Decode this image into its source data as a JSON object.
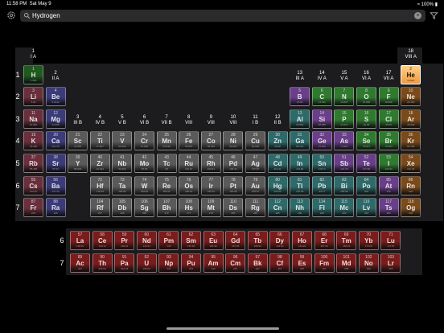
{
  "status": {
    "time": "11:58 PM",
    "date": "Sat May 9",
    "battery": "100%"
  },
  "search": {
    "value": "Hydrogen",
    "clear_icon": "clear-circle-icon"
  },
  "colors": {
    "alkali": "#6a2f3c",
    "alkaline": "#3b3b7a",
    "transition": "#5a5a5a",
    "lanthanide": "#7a1c1c",
    "actinide": "#7a1c1c",
    "post_transition": "#2f6a6a",
    "metalloid": "#6a3f8a",
    "nonmetal": "#2f7a2f",
    "halogen": "#6a6a2a",
    "noble": "#7a4a1a",
    "selected": "#f29a3a",
    "hydrogen": "#1f5a1f"
  },
  "groups": [
    {
      "num": "1",
      "sub": "I A"
    },
    {
      "num": "2",
      "sub": "II A"
    },
    {
      "num": "3",
      "sub": "III B"
    },
    {
      "num": "4",
      "sub": "IV B"
    },
    {
      "num": "5",
      "sub": "V B"
    },
    {
      "num": "6",
      "sub": "VI B"
    },
    {
      "num": "7",
      "sub": "VII B"
    },
    {
      "num": "8",
      "sub": "VIII"
    },
    {
      "num": "9",
      "sub": "VIII"
    },
    {
      "num": "10",
      "sub": "VIII"
    },
    {
      "num": "11",
      "sub": "I B"
    },
    {
      "num": "12",
      "sub": "II B"
    },
    {
      "num": "13",
      "sub": "III A"
    },
    {
      "num": "14",
      "sub": "IV A"
    },
    {
      "num": "15",
      "sub": "V A"
    },
    {
      "num": "16",
      "sub": "VI A"
    },
    {
      "num": "17",
      "sub": "VII A"
    },
    {
      "num": "18",
      "sub": "VIII A"
    }
  ],
  "periods": [
    "1",
    "2",
    "3",
    "4",
    "5",
    "6",
    "7"
  ],
  "fblock_periods": [
    "6",
    "7"
  ],
  "elements": [
    {
      "z": 1,
      "s": "H",
      "m": "1.008",
      "g": 1,
      "p": 1,
      "c": "hydrogen"
    },
    {
      "z": 2,
      "s": "He",
      "m": "4.0026",
      "g": 18,
      "p": 1,
      "c": "selected",
      "sel": true
    },
    {
      "z": 3,
      "s": "Li",
      "m": "6.94",
      "g": 1,
      "p": 2,
      "c": "alkali"
    },
    {
      "z": 4,
      "s": "Be",
      "m": "9.0122",
      "g": 2,
      "p": 2,
      "c": "alkaline"
    },
    {
      "z": 5,
      "s": "B",
      "m": "10.81",
      "g": 13,
      "p": 2,
      "c": "metalloid"
    },
    {
      "z": 6,
      "s": "C",
      "m": "12.011",
      "g": 14,
      "p": 2,
      "c": "nonmetal"
    },
    {
      "z": 7,
      "s": "N",
      "m": "14.007",
      "g": 15,
      "p": 2,
      "c": "nonmetal"
    },
    {
      "z": 8,
      "s": "O",
      "m": "15.999",
      "g": 16,
      "p": 2,
      "c": "nonmetal"
    },
    {
      "z": 9,
      "s": "F",
      "m": "18.998",
      "g": 17,
      "p": 2,
      "c": "nonmetal"
    },
    {
      "z": 10,
      "s": "Ne",
      "m": "20.180",
      "g": 18,
      "p": 2,
      "c": "noble"
    },
    {
      "z": 11,
      "s": "Na",
      "m": "22.990",
      "g": 1,
      "p": 3,
      "c": "alkali"
    },
    {
      "z": 12,
      "s": "Mg",
      "m": "24.305",
      "g": 2,
      "p": 3,
      "c": "alkaline"
    },
    {
      "z": 13,
      "s": "Al",
      "m": "26.982",
      "g": 13,
      "p": 3,
      "c": "post_transition"
    },
    {
      "z": 14,
      "s": "Si",
      "m": "28.085",
      "g": 14,
      "p": 3,
      "c": "metalloid"
    },
    {
      "z": 15,
      "s": "P",
      "m": "30.974",
      "g": 15,
      "p": 3,
      "c": "nonmetal"
    },
    {
      "z": 16,
      "s": "S",
      "m": "32.06",
      "g": 16,
      "p": 3,
      "c": "nonmetal"
    },
    {
      "z": 17,
      "s": "Cl",
      "m": "35.45",
      "g": 17,
      "p": 3,
      "c": "nonmetal"
    },
    {
      "z": 18,
      "s": "Ar",
      "m": "39.948",
      "g": 18,
      "p": 3,
      "c": "noble"
    },
    {
      "z": 19,
      "s": "K",
      "m": "39.098",
      "g": 1,
      "p": 4,
      "c": "alkali"
    },
    {
      "z": 20,
      "s": "Ca",
      "m": "40.078",
      "g": 2,
      "p": 4,
      "c": "alkaline"
    },
    {
      "z": 21,
      "s": "Sc",
      "m": "44.956",
      "g": 3,
      "p": 4,
      "c": "transition"
    },
    {
      "z": 22,
      "s": "Ti",
      "m": "47.867",
      "g": 4,
      "p": 4,
      "c": "transition"
    },
    {
      "z": 23,
      "s": "V",
      "m": "50.942",
      "g": 5,
      "p": 4,
      "c": "transition"
    },
    {
      "z": 24,
      "s": "Cr",
      "m": "51.996",
      "g": 6,
      "p": 4,
      "c": "transition"
    },
    {
      "z": 25,
      "s": "Mn",
      "m": "54.938",
      "g": 7,
      "p": 4,
      "c": "transition"
    },
    {
      "z": 26,
      "s": "Fe",
      "m": "55.845",
      "g": 8,
      "p": 4,
      "c": "transition"
    },
    {
      "z": 27,
      "s": "Co",
      "m": "58.933",
      "g": 9,
      "p": 4,
      "c": "transition"
    },
    {
      "z": 28,
      "s": "Ni",
      "m": "58.693",
      "g": 10,
      "p": 4,
      "c": "transition"
    },
    {
      "z": 29,
      "s": "Cu",
      "m": "63.546",
      "g": 11,
      "p": 4,
      "c": "transition"
    },
    {
      "z": 30,
      "s": "Zn",
      "m": "65.38",
      "g": 12,
      "p": 4,
      "c": "post_transition"
    },
    {
      "z": 31,
      "s": "Ga",
      "m": "69.723",
      "g": 13,
      "p": 4,
      "c": "post_transition"
    },
    {
      "z": 32,
      "s": "Ge",
      "m": "72.630",
      "g": 14,
      "p": 4,
      "c": "metalloid"
    },
    {
      "z": 33,
      "s": "As",
      "m": "74.922",
      "g": 15,
      "p": 4,
      "c": "metalloid"
    },
    {
      "z": 34,
      "s": "Se",
      "m": "78.971",
      "g": 16,
      "p": 4,
      "c": "nonmetal"
    },
    {
      "z": 35,
      "s": "Br",
      "m": "79.904",
      "g": 17,
      "p": 4,
      "c": "nonmetal"
    },
    {
      "z": 36,
      "s": "Kr",
      "m": "83.798",
      "g": 18,
      "p": 4,
      "c": "noble"
    },
    {
      "z": 37,
      "s": "Rb",
      "m": "85.468",
      "g": 1,
      "p": 5,
      "c": "alkali"
    },
    {
      "z": 38,
      "s": "Sr",
      "m": "87.62",
      "g": 2,
      "p": 5,
      "c": "alkaline"
    },
    {
      "z": 39,
      "s": "Y",
      "m": "88.906",
      "g": 3,
      "p": 5,
      "c": "transition"
    },
    {
      "z": 40,
      "s": "Zr",
      "m": "91.224",
      "g": 4,
      "p": 5,
      "c": "transition"
    },
    {
      "z": 41,
      "s": "Nb",
      "m": "92.906",
      "g": 5,
      "p": 5,
      "c": "transition"
    },
    {
      "z": 42,
      "s": "Mo",
      "m": "95.95",
      "g": 6,
      "p": 5,
      "c": "transition"
    },
    {
      "z": 43,
      "s": "Tc",
      "m": "98",
      "g": 7,
      "p": 5,
      "c": "transition"
    },
    {
      "z": 44,
      "s": "Ru",
      "m": "101.07",
      "g": 8,
      "p": 5,
      "c": "transition"
    },
    {
      "z": 45,
      "s": "Rh",
      "m": "102.91",
      "g": 9,
      "p": 5,
      "c": "transition"
    },
    {
      "z": 46,
      "s": "Pd",
      "m": "106.42",
      "g": 10,
      "p": 5,
      "c": "transition"
    },
    {
      "z": 47,
      "s": "Ag",
      "m": "107.87",
      "g": 11,
      "p": 5,
      "c": "transition"
    },
    {
      "z": 48,
      "s": "Cd",
      "m": "112.41",
      "g": 12,
      "p": 5,
      "c": "post_transition"
    },
    {
      "z": 49,
      "s": "In",
      "m": "114.82",
      "g": 13,
      "p": 5,
      "c": "post_transition"
    },
    {
      "z": 50,
      "s": "Sn",
      "m": "118.71",
      "g": 14,
      "p": 5,
      "c": "post_transition"
    },
    {
      "z": 51,
      "s": "Sb",
      "m": "121.76",
      "g": 15,
      "p": 5,
      "c": "metalloid"
    },
    {
      "z": 52,
      "s": "Te",
      "m": "127.60",
      "g": 16,
      "p": 5,
      "c": "metalloid"
    },
    {
      "z": 53,
      "s": "I",
      "m": "126.90",
      "g": 17,
      "p": 5,
      "c": "nonmetal"
    },
    {
      "z": 54,
      "s": "Xe",
      "m": "131.29",
      "g": 18,
      "p": 5,
      "c": "noble"
    },
    {
      "z": 55,
      "s": "Cs",
      "m": "132.91",
      "g": 1,
      "p": 6,
      "c": "alkali"
    },
    {
      "z": 56,
      "s": "Ba",
      "m": "137.33",
      "g": 2,
      "p": 6,
      "c": "alkaline"
    },
    {
      "z": 72,
      "s": "Hf",
      "m": "178.49",
      "g": 4,
      "p": 6,
      "c": "transition"
    },
    {
      "z": 73,
      "s": "Ta",
      "m": "180.95",
      "g": 5,
      "p": 6,
      "c": "transition"
    },
    {
      "z": 74,
      "s": "W",
      "m": "183.84",
      "g": 6,
      "p": 6,
      "c": "transition"
    },
    {
      "z": 75,
      "s": "Re",
      "m": "186.21",
      "g": 7,
      "p": 6,
      "c": "transition"
    },
    {
      "z": 76,
      "s": "Os",
      "m": "190.23",
      "g": 8,
      "p": 6,
      "c": "transition"
    },
    {
      "z": 77,
      "s": "Ir",
      "m": "192.22",
      "g": 9,
      "p": 6,
      "c": "transition"
    },
    {
      "z": 78,
      "s": "Pt",
      "m": "195.08",
      "g": 10,
      "p": 6,
      "c": "transition"
    },
    {
      "z": 79,
      "s": "Au",
      "m": "196.97",
      "g": 11,
      "p": 6,
      "c": "transition"
    },
    {
      "z": 80,
      "s": "Hg",
      "m": "200.59",
      "g": 12,
      "p": 6,
      "c": "post_transition"
    },
    {
      "z": 81,
      "s": "Tl",
      "m": "204.38",
      "g": 13,
      "p": 6,
      "c": "post_transition"
    },
    {
      "z": 82,
      "s": "Pb",
      "m": "207.2",
      "g": 14,
      "p": 6,
      "c": "post_transition"
    },
    {
      "z": 83,
      "s": "Bi",
      "m": "208.98",
      "g": 15,
      "p": 6,
      "c": "post_transition"
    },
    {
      "z": 84,
      "s": "Po",
      "m": "209",
      "g": 16,
      "p": 6,
      "c": "post_transition"
    },
    {
      "z": 85,
      "s": "At",
      "m": "210",
      "g": 17,
      "p": 6,
      "c": "metalloid"
    },
    {
      "z": 86,
      "s": "Rn",
      "m": "222",
      "g": 18,
      "p": 6,
      "c": "noble"
    },
    {
      "z": 87,
      "s": "Fr",
      "m": "223",
      "g": 1,
      "p": 7,
      "c": "alkali"
    },
    {
      "z": 88,
      "s": "Ra",
      "m": "226",
      "g": 2,
      "p": 7,
      "c": "alkaline"
    },
    {
      "z": 104,
      "s": "Rf",
      "m": "267",
      "g": 4,
      "p": 7,
      "c": "transition"
    },
    {
      "z": 105,
      "s": "Db",
      "m": "268",
      "g": 5,
      "p": 7,
      "c": "transition"
    },
    {
      "z": 106,
      "s": "Sg",
      "m": "269",
      "g": 6,
      "p": 7,
      "c": "transition"
    },
    {
      "z": 107,
      "s": "Bh",
      "m": "270",
      "g": 7,
      "p": 7,
      "c": "transition"
    },
    {
      "z": 108,
      "s": "Hs",
      "m": "277",
      "g": 8,
      "p": 7,
      "c": "transition"
    },
    {
      "z": 109,
      "s": "Mt",
      "m": "278",
      "g": 9,
      "p": 7,
      "c": "transition"
    },
    {
      "z": 110,
      "s": "Ds",
      "m": "281",
      "g": 10,
      "p": 7,
      "c": "transition"
    },
    {
      "z": 111,
      "s": "Rg",
      "m": "282",
      "g": 11,
      "p": 7,
      "c": "transition"
    },
    {
      "z": 112,
      "s": "Cn",
      "m": "285",
      "g": 12,
      "p": 7,
      "c": "post_transition"
    },
    {
      "z": 113,
      "s": "Nh",
      "m": "286",
      "g": 13,
      "p": 7,
      "c": "post_transition"
    },
    {
      "z": 114,
      "s": "Fl",
      "m": "289",
      "g": 14,
      "p": 7,
      "c": "post_transition"
    },
    {
      "z": 115,
      "s": "Mc",
      "m": "290",
      "g": 15,
      "p": 7,
      "c": "post_transition"
    },
    {
      "z": 116,
      "s": "Lv",
      "m": "293",
      "g": 16,
      "p": 7,
      "c": "post_transition"
    },
    {
      "z": 117,
      "s": "Ts",
      "m": "294",
      "g": 17,
      "p": 7,
      "c": "metalloid"
    },
    {
      "z": 118,
      "s": "Og",
      "m": "294",
      "g": 18,
      "p": 7,
      "c": "noble"
    }
  ],
  "lanthanides": [
    {
      "z": 57,
      "s": "La",
      "m": "138.91"
    },
    {
      "z": 58,
      "s": "Ce",
      "m": "140.12"
    },
    {
      "z": 59,
      "s": "Pr",
      "m": "140.91"
    },
    {
      "z": 60,
      "s": "Nd",
      "m": "144.24"
    },
    {
      "z": 61,
      "s": "Pm",
      "m": "145"
    },
    {
      "z": 62,
      "s": "Sm",
      "m": "150.36"
    },
    {
      "z": 63,
      "s": "Eu",
      "m": "151.96"
    },
    {
      "z": 64,
      "s": "Gd",
      "m": "157.25"
    },
    {
      "z": 65,
      "s": "Tb",
      "m": "158.93"
    },
    {
      "z": 66,
      "s": "Dy",
      "m": "162.50"
    },
    {
      "z": 67,
      "s": "Ho",
      "m": "164.93"
    },
    {
      "z": 68,
      "s": "Er",
      "m": "167.26"
    },
    {
      "z": 69,
      "s": "Tm",
      "m": "168.93"
    },
    {
      "z": 70,
      "s": "Yb",
      "m": "173.05"
    },
    {
      "z": 71,
      "s": "Lu",
      "m": "174.97"
    }
  ],
  "actinides": [
    {
      "z": 89,
      "s": "Ac",
      "m": "227"
    },
    {
      "z": 90,
      "s": "Th",
      "m": "232.04"
    },
    {
      "z": 91,
      "s": "Pa",
      "m": "231.04"
    },
    {
      "z": 92,
      "s": "U",
      "m": "238.03"
    },
    {
      "z": 93,
      "s": "Np",
      "m": "237"
    },
    {
      "z": 94,
      "s": "Pu",
      "m": "244"
    },
    {
      "z": 95,
      "s": "Am",
      "m": "243"
    },
    {
      "z": 96,
      "s": "Cm",
      "m": "247"
    },
    {
      "z": 97,
      "s": "Bk",
      "m": "247"
    },
    {
      "z": 98,
      "s": "Cf",
      "m": "251"
    },
    {
      "z": 99,
      "s": "Es",
      "m": "252"
    },
    {
      "z": 100,
      "s": "Fm",
      "m": "257"
    },
    {
      "z": 101,
      "s": "Md",
      "m": "258"
    },
    {
      "z": 102,
      "s": "No",
      "m": "259"
    },
    {
      "z": 103,
      "s": "Lr",
      "m": "266"
    }
  ]
}
